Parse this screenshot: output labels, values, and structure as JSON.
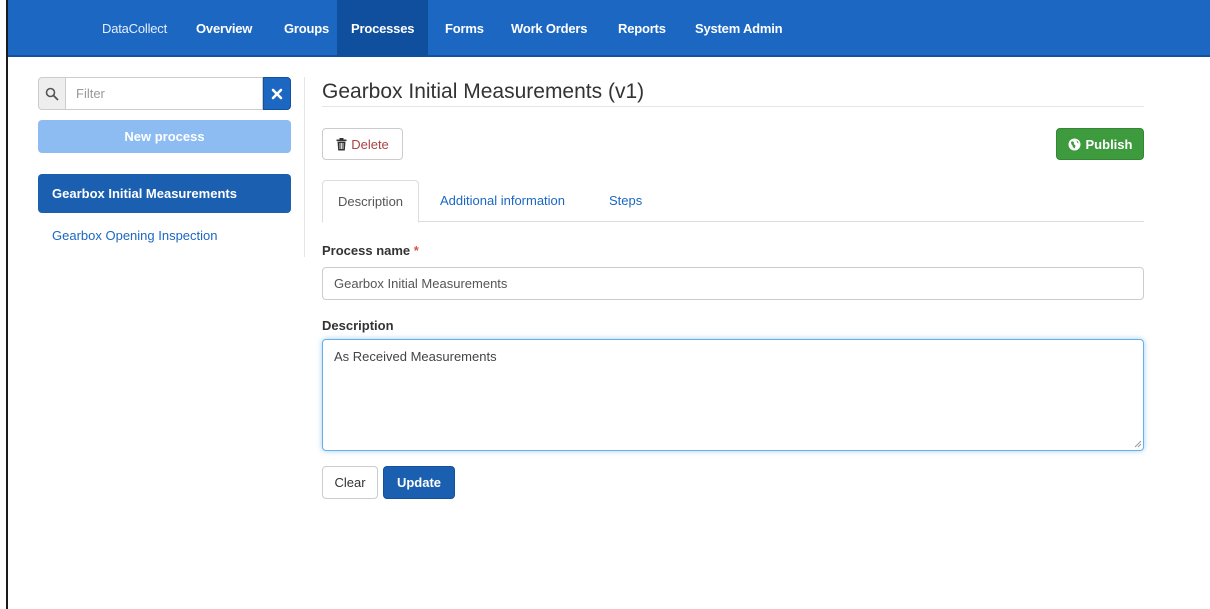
{
  "navbar": {
    "brand": "DataCollect",
    "items": [
      {
        "label": "Overview"
      },
      {
        "label": "Groups"
      },
      {
        "label": "Processes",
        "active": true
      },
      {
        "label": "Forms"
      },
      {
        "label": "Work Orders"
      },
      {
        "label": "Reports"
      },
      {
        "label": "System Admin"
      }
    ]
  },
  "sidebar": {
    "filter_placeholder": "Filter",
    "search_icon": "search-icon",
    "clear_icon": "close-icon",
    "new_process_label": "New process",
    "items": [
      {
        "label": "Gearbox Initial Measurements",
        "active": true
      },
      {
        "label": "Gearbox Opening Inspection",
        "active": false
      }
    ]
  },
  "main": {
    "title": "Gearbox Initial Measurements (v1)",
    "delete_label": "Delete",
    "delete_icon": "trash-icon",
    "publish_label": "Publish",
    "publish_icon": "globe-icon",
    "tabs": [
      {
        "label": "Description",
        "active": true
      },
      {
        "label": "Additional information",
        "active": false
      },
      {
        "label": "Steps",
        "active": false
      }
    ],
    "form": {
      "process_name_label": "Process name",
      "required_marker": "*",
      "process_name_value": "Gearbox Initial Measurements",
      "description_label": "Description",
      "description_value": "As Received Measurements",
      "clear_label": "Clear",
      "update_label": "Update"
    }
  },
  "colors": {
    "navbar": "#1b67c2",
    "active_nav": "#0f4f9e",
    "primary": "#1b5fb0",
    "success": "#3d9a3d",
    "danger": "#a94442"
  }
}
